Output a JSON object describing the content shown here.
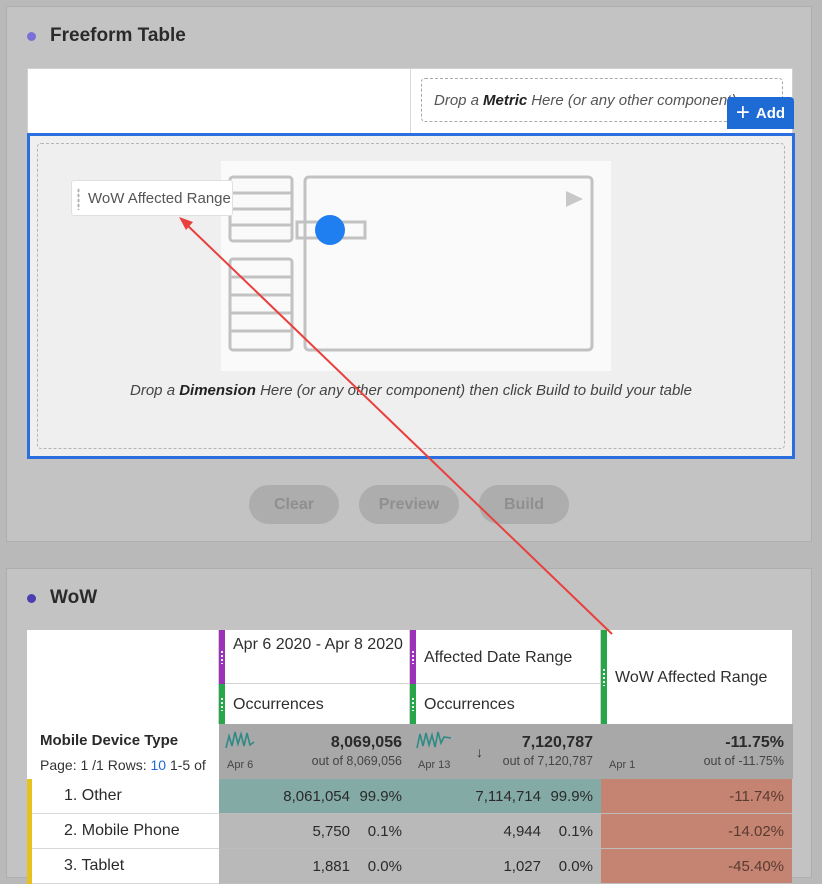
{
  "freeform": {
    "title": "Freeform Table",
    "metric_drop_prefix": "Drop a",
    "metric_drop_strong": "Metric",
    "metric_drop_suffix": "Here (or any other component)",
    "add_label": "Add",
    "dimension_chip": "WoW Affected Range",
    "dimension_drop_prefix": "Drop a",
    "dimension_drop_strong": "Dimension",
    "dimension_drop_suffix": "Here (or any other component) then click Build to build your table",
    "buttons": {
      "clear": "Clear",
      "preview": "Preview",
      "build": "Build"
    }
  },
  "wow": {
    "title": "WoW",
    "columns": [
      {
        "header": "Apr 6 2020 - Apr 8 2020",
        "metric": "Occurrences",
        "total": "8,069,056",
        "out_of": "out of 8,069,056",
        "spark_date": "Apr 6"
      },
      {
        "header": "Affected Date Range",
        "metric": "Occurrences",
        "total": "7,120,787",
        "out_of": "out of 7,120,787",
        "spark_date": "Apr 13",
        "sort_icon": "↓"
      },
      {
        "header": "WoW Affected Range",
        "total": "-11.75%",
        "out_of": "out of -11.75%",
        "spark_date": "Apr 1"
      }
    ],
    "dimension_label": "Mobile Device Type",
    "pagination": {
      "page": "Page: 1 /1",
      "rows_label": "Rows:",
      "rows_value": "10",
      "range": "1-5 of"
    },
    "rows": [
      {
        "label": "1.  Other",
        "c1": "8,061,054",
        "c1p": "99.9%",
        "c2": "7,114,714",
        "c2p": "99.9%",
        "c3": "-11.74%"
      },
      {
        "label": "2.  Mobile Phone",
        "c1": "5,750",
        "c1p": "0.1%",
        "c2": "4,944",
        "c2p": "0.1%",
        "c3": "-14.02%"
      },
      {
        "label": "3.  Tablet",
        "c1": "1,881",
        "c1p": "0.0%",
        "c2": "1,027",
        "c2p": "0.0%",
        "c3": "-45.40%"
      }
    ]
  },
  "colors": {
    "accent": "#1f6bd6",
    "purple": "#9b32b9",
    "green": "#27a64a",
    "annotation": "#e8403d"
  }
}
